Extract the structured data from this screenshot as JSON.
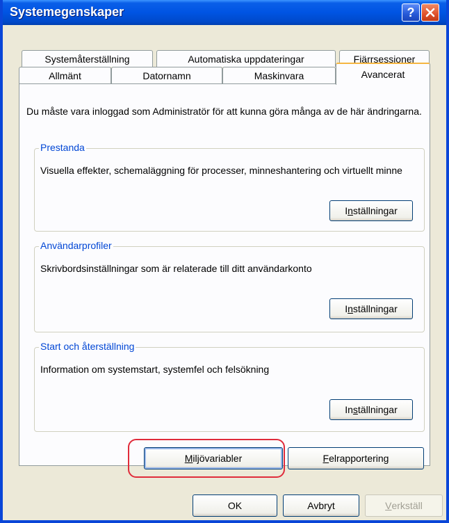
{
  "window": {
    "title": "Systemegenskaper"
  },
  "tabs_row1": [
    "Systemåterställning",
    "Automatiska uppdateringar",
    "Fjärrsessioner"
  ],
  "tabs_row2": [
    "Allmänt",
    "Datornamn",
    "Maskinvara",
    "Avancerat"
  ],
  "active_tab": "Avancerat",
  "intro_text": "Du måste vara inloggad som Administratör för att kunna göra många av de här ändringarna.",
  "groups": [
    {
      "legend": "Prestanda",
      "description": "Visuella effekter, schemaläggning för processer, minneshantering och virtuellt minne",
      "button_pre": "I",
      "button_mn": "n",
      "button_post": "ställningar"
    },
    {
      "legend": "Användarprofiler",
      "description": "Skrivbordsinställningar som är relaterade till ditt användarkonto",
      "button_pre": "I",
      "button_mn": "n",
      "button_post": "ställningar"
    },
    {
      "legend": "Start och återställning",
      "description": "Information om systemstart, systemfel och felsökning",
      "button_pre": "In",
      "button_mn": "s",
      "button_post": "tällningar"
    }
  ],
  "env_button": {
    "pre": "",
    "mn": "M",
    "post": "iljövariabler"
  },
  "error_button": {
    "pre": "",
    "mn": "F",
    "post": "elrapportering"
  },
  "dialog_buttons": {
    "ok": "OK",
    "cancel": "Avbryt",
    "apply_mn": "V",
    "apply_post": "erkställ"
  },
  "colors": {
    "highlight": "#e02b3a",
    "titlebar": "#0054e3",
    "legend": "#0046d5"
  }
}
